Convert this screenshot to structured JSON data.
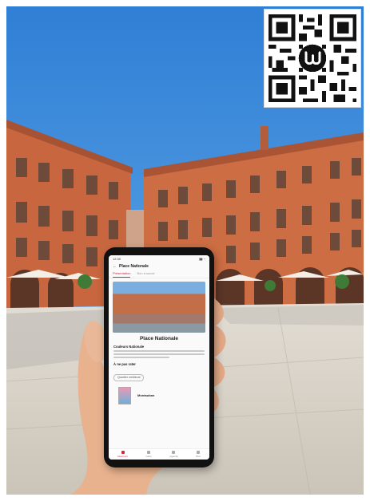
{
  "phone_screen": {
    "app_title": "Place Nationale",
    "tabs": [
      "Présentation",
      "Bon à savoir"
    ],
    "place_title": "Place Nationale",
    "section_title": "Couleurs Nationale",
    "related_title": "À ne pas rater",
    "chip_label": "Quartier médiéval",
    "brand_label": "Montauban",
    "nav_items": [
      "Découvrir",
      "Carte",
      "Agenda",
      "Plus"
    ]
  },
  "colors": {
    "sky": "#3a86d8",
    "brick": "#c8673f",
    "pavement": "#d8d2c8",
    "accent": "#d12a3b"
  },
  "icons": [
    "qr-code-icon",
    "back-arrow-icon",
    "logo-icon"
  ]
}
